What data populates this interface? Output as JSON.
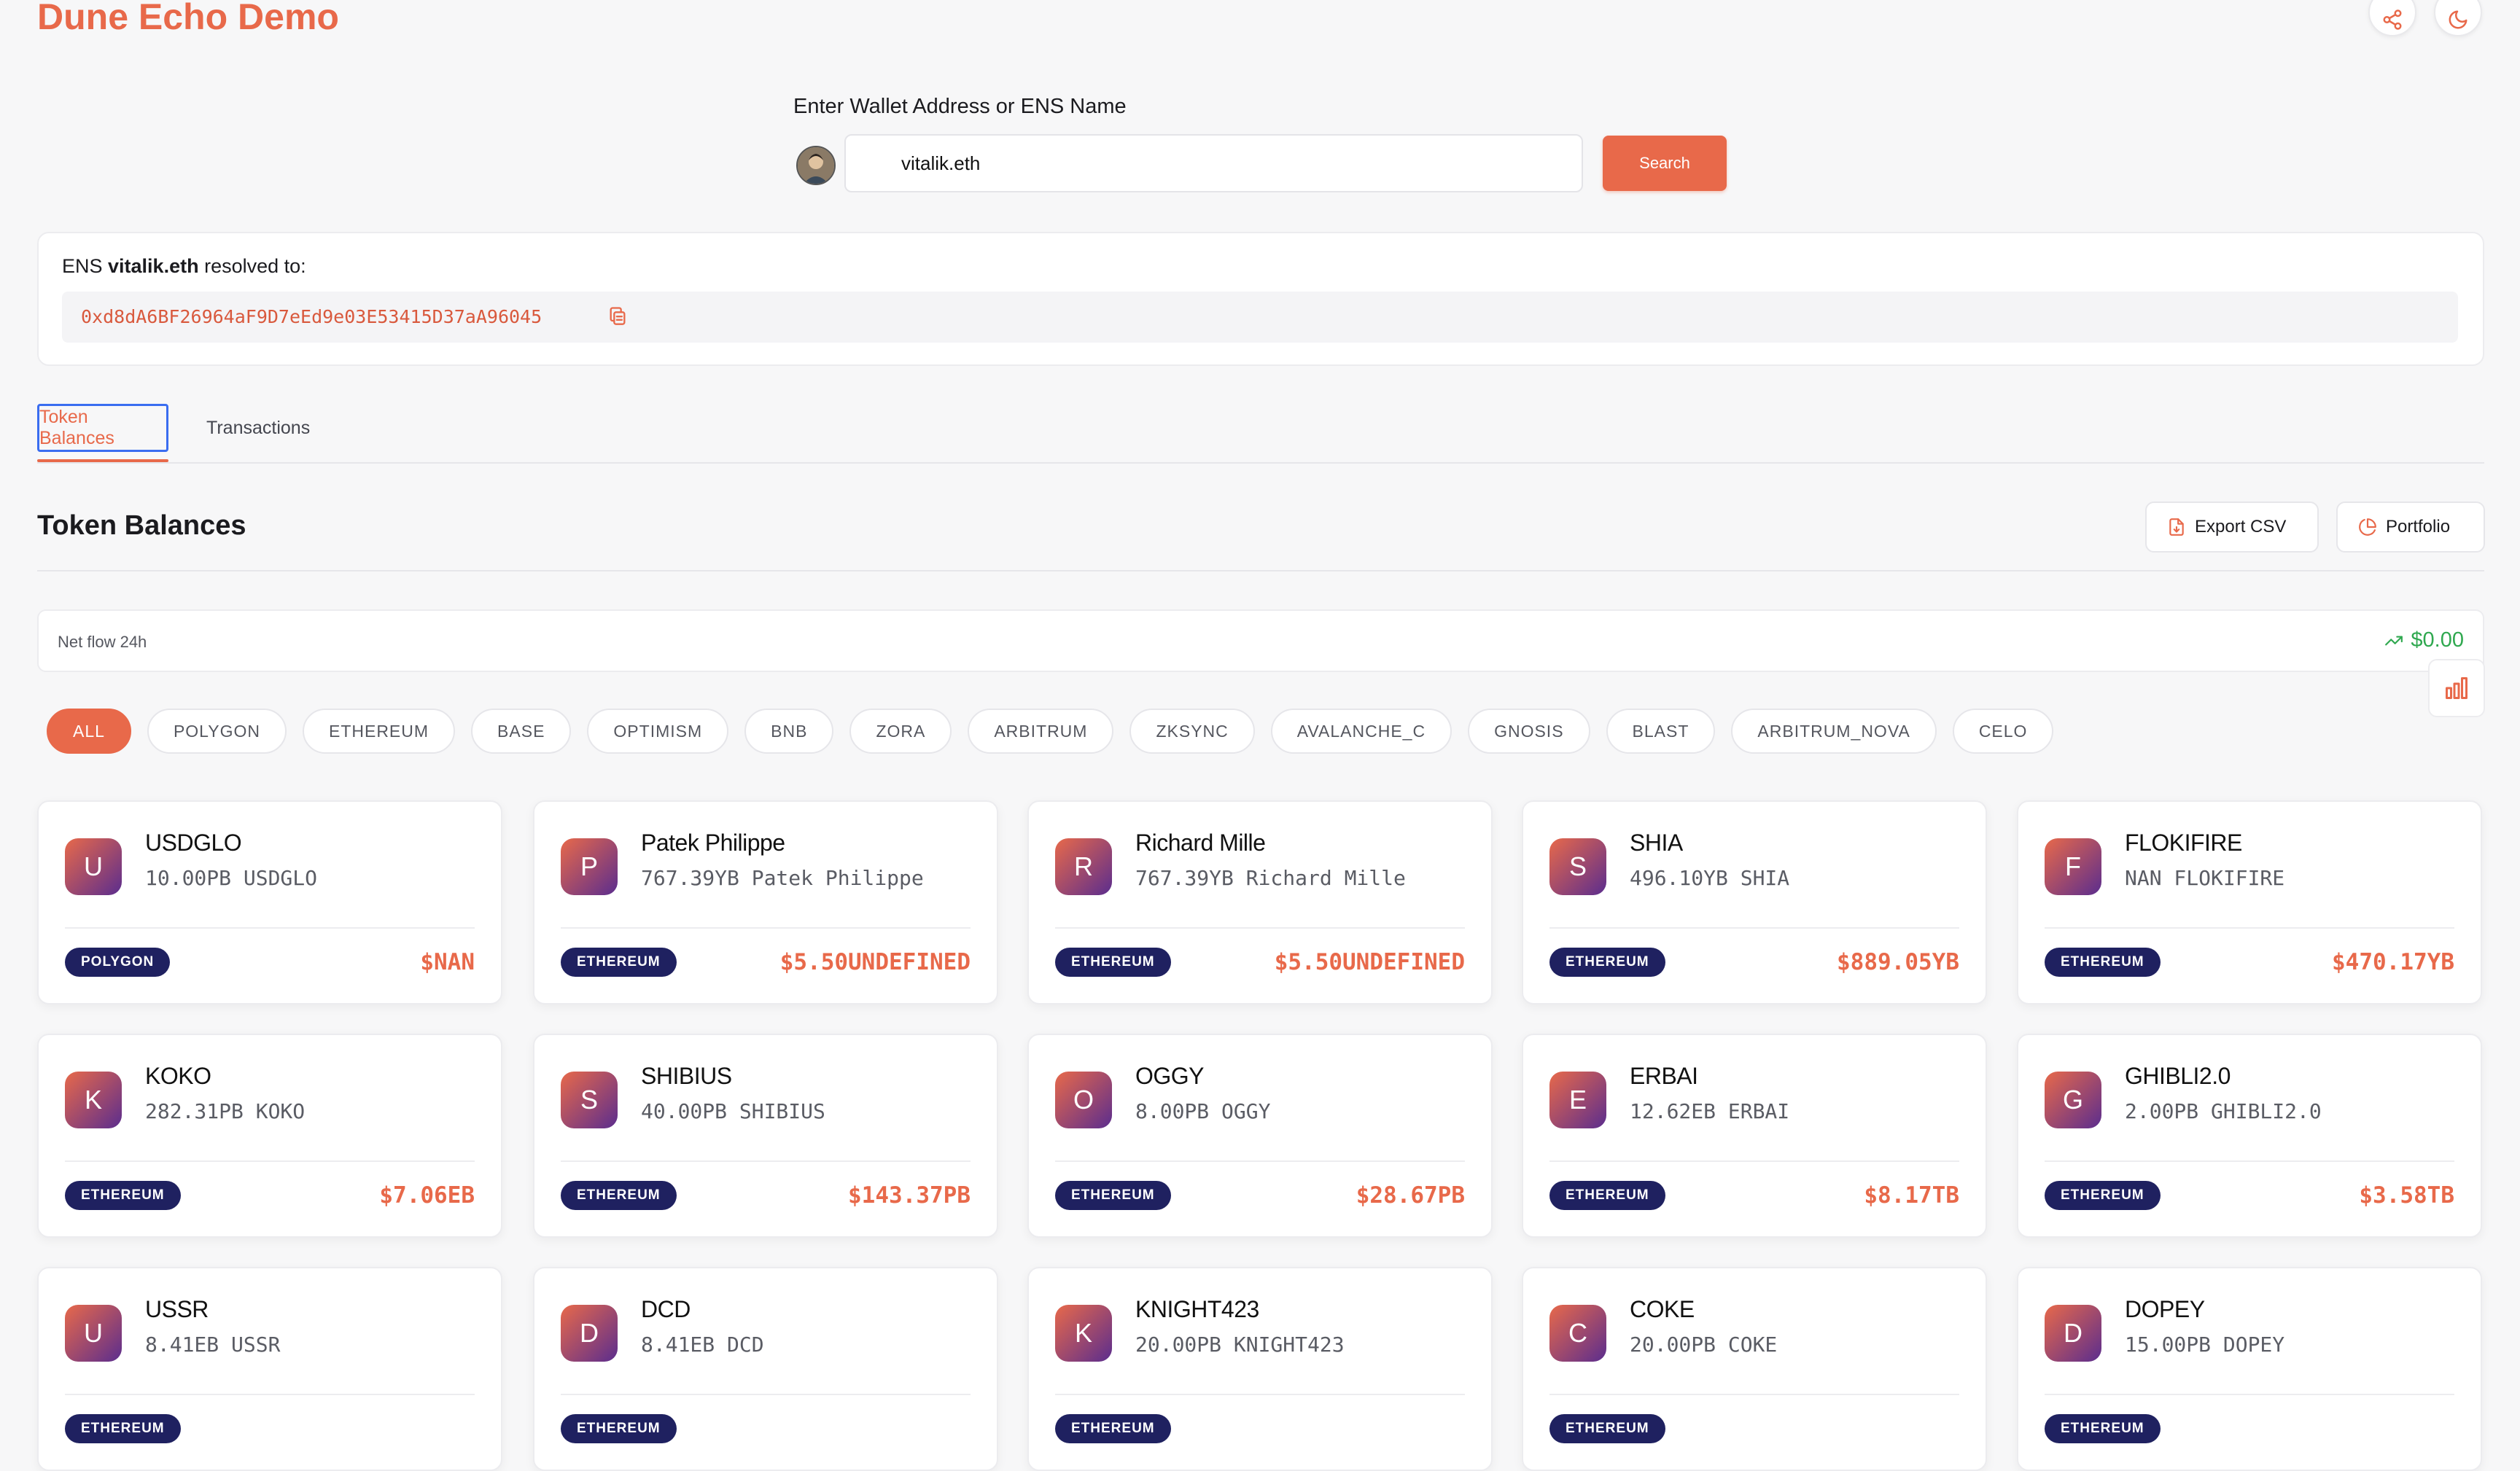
{
  "app": {
    "title": "Dune Echo Demo"
  },
  "header": {
    "share_icon": "share-icon",
    "theme_icon": "moon-icon"
  },
  "search": {
    "label": "Enter Wallet Address or ENS Name",
    "value": "vitalik.eth",
    "button": "Search"
  },
  "ens": {
    "prefix": "ENS ",
    "name": "vitalik.eth",
    "suffix": " resolved to:",
    "address": "0xd8dA6BF26964aF9D7eEd9e03E53415D37aA96045"
  },
  "tabs": [
    {
      "label": "Token Balances",
      "active": true
    },
    {
      "label": "Transactions",
      "active": false
    }
  ],
  "section": {
    "title": "Token Balances",
    "export_label": "Export CSV",
    "portfolio_label": "Portfolio"
  },
  "netflow": {
    "label": "Net flow 24h",
    "value": "$0.00",
    "color": "#2fa84f"
  },
  "filters": [
    "ALL",
    "POLYGON",
    "ETHEREUM",
    "BASE",
    "OPTIMISM",
    "BNB",
    "ZORA",
    "ARBITRUM",
    "ZKSYNC",
    "AVALANCHE_C",
    "GNOSIS",
    "BLAST",
    "ARBITRUM_NOVA",
    "CELO"
  ],
  "tokens": [
    {
      "letter": "U",
      "name": "USDGLO",
      "balance": "10.00PB USDGLO",
      "chain": "POLYGON",
      "value": "$NAN"
    },
    {
      "letter": "P",
      "name": "Patek Philippe",
      "balance": "767.39YB Patek Philippe",
      "chain": "ETHEREUM",
      "value": "$5.50UNDEFINED"
    },
    {
      "letter": "R",
      "name": "Richard Mille",
      "balance": "767.39YB Richard Mille",
      "chain": "ETHEREUM",
      "value": "$5.50UNDEFINED"
    },
    {
      "letter": "S",
      "name": "SHIA",
      "balance": "496.10YB SHIA",
      "chain": "ETHEREUM",
      "value": "$889.05YB"
    },
    {
      "letter": "F",
      "name": "FLOKIFIRE",
      "balance": "NAN FLOKIFIRE",
      "chain": "ETHEREUM",
      "value": "$470.17YB"
    },
    {
      "letter": "K",
      "name": "KOKO",
      "balance": "282.31PB KOKO",
      "chain": "ETHEREUM",
      "value": "$7.06EB"
    },
    {
      "letter": "S",
      "name": "SHIBIUS",
      "balance": "40.00PB SHIBIUS",
      "chain": "ETHEREUM",
      "value": "$143.37PB"
    },
    {
      "letter": "O",
      "name": "OGGY",
      "balance": "8.00PB OGGY",
      "chain": "ETHEREUM",
      "value": "$28.67PB"
    },
    {
      "letter": "E",
      "name": "ERBAI",
      "balance": "12.62EB ERBAI",
      "chain": "ETHEREUM",
      "value": "$8.17TB"
    },
    {
      "letter": "G",
      "name": "GHIBLI2.0",
      "balance": "2.00PB GHIBLI2.0",
      "chain": "ETHEREUM",
      "value": "$3.58TB"
    },
    {
      "letter": "U",
      "name": "USSR",
      "balance": "8.41EB USSR",
      "chain": "ETHEREUM",
      "value": ""
    },
    {
      "letter": "D",
      "name": "DCD",
      "balance": "8.41EB DCD",
      "chain": "ETHEREUM",
      "value": ""
    },
    {
      "letter": "K",
      "name": "KNIGHT423",
      "balance": "20.00PB KNIGHT423",
      "chain": "ETHEREUM",
      "value": ""
    },
    {
      "letter": "C",
      "name": "COKE",
      "balance": "20.00PB COKE",
      "chain": "ETHEREUM",
      "value": ""
    },
    {
      "letter": "D",
      "name": "DOPEY",
      "balance": "15.00PB DOPEY",
      "chain": "ETHEREUM",
      "value": ""
    }
  ],
  "colors": {
    "accent": "#e8694a",
    "badge": "#1f2160",
    "positive": "#2fa84f"
  }
}
